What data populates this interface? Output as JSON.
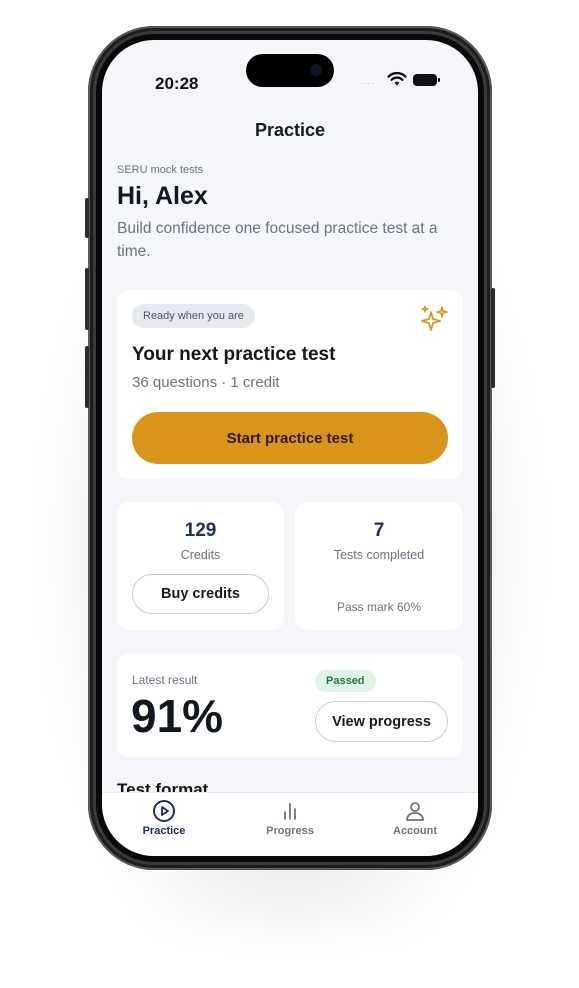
{
  "status_bar": {
    "time": "20:28",
    "signal": "....",
    "icons": [
      "wifi-icon",
      "battery-icon"
    ]
  },
  "nav": {
    "title": "Practice"
  },
  "header": {
    "eyebrow": "SERU mock tests",
    "greeting": "Hi, Alex",
    "subtitle": "Build confidence one focused practice test at a time."
  },
  "next_test": {
    "badge": "Ready when you are",
    "title": "Your next practice test",
    "meta": "36 questions · 1 credit",
    "cta": "Start practice test",
    "icon": "sparkles-icon"
  },
  "stats": {
    "credits_value": "129",
    "credits_label": "Credits",
    "buy_label": "Buy credits",
    "tests_value": "7",
    "tests_label": "Tests completed",
    "pass_mark": "Pass mark 60%"
  },
  "latest": {
    "label": "Latest result",
    "value": "91%",
    "status": "Passed",
    "button": "View progress"
  },
  "next_section": {
    "title": "Test format"
  },
  "tabs": [
    {
      "label": "Practice",
      "icon": "play-circle-icon",
      "active": true
    },
    {
      "label": "Progress",
      "icon": "bar-chart-icon",
      "active": false
    },
    {
      "label": "Account",
      "icon": "person-icon",
      "active": false
    }
  ],
  "colors": {
    "accent": "#d9951a",
    "primary_text": "#1f2a6b",
    "success_bg": "#dff3e6",
    "success_text": "#1f7a3d",
    "background": "#f4f6fa"
  }
}
